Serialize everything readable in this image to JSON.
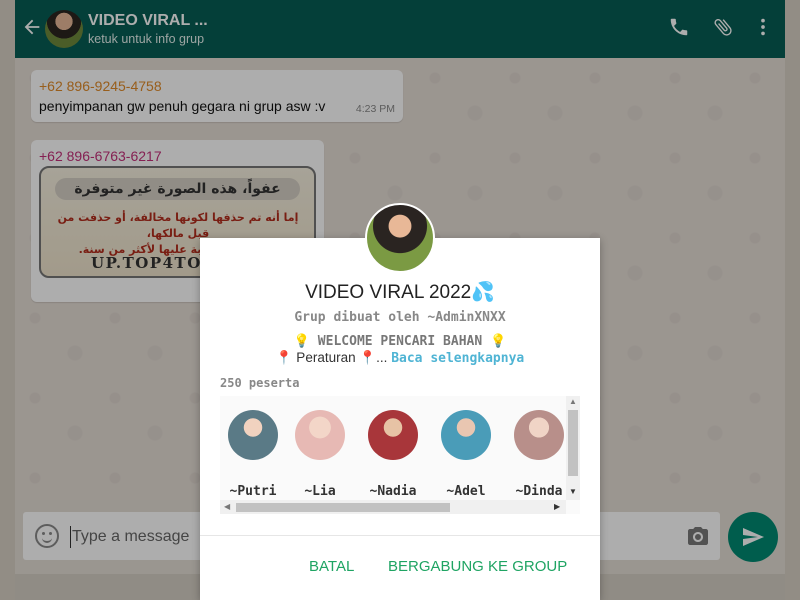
{
  "header": {
    "title": "VIDEO VIRAL ...",
    "subtitle": "ketuk untuk info grup",
    "icons": [
      "back-arrow-icon",
      "phone-icon",
      "paperclip-icon",
      "more-vert-icon"
    ]
  },
  "messages": [
    {
      "sender": "+62 896-9245-4758",
      "text": "penyimpanan gw penuh gegara ni grup asw :v",
      "time": "4:23 PM"
    },
    {
      "sender": "+62 896-6763-6217",
      "image": {
        "line1": "عفواً، هذه الصورة غير متوفرة",
        "line2": "إما أنه تم حذفها لكونها مخالفة، أو حذفت من قبل مالكها،",
        "line3": "أو تمت المطالبة عليها لأكثر من سنة.",
        "watermark": "UP.TOP4TO"
      }
    }
  ],
  "input": {
    "placeholder": "Type a message"
  },
  "dialog": {
    "title": "VIDEO VIRAL 2022💦",
    "creator": "Grup dibuat oleh ~AdminXNXX",
    "desc_line1": "💡 WELCOME PENCARI BAHAN 💡",
    "desc_rules": "📍 Peraturan 📍...",
    "read_more": "Baca selengkapnya",
    "participants": "250 peserta",
    "members": [
      {
        "name": "~Putri",
        "color": "#5a7a86"
      },
      {
        "name": "~Lia",
        "color": "#e7b9b4"
      },
      {
        "name": "~Nadia",
        "color": "#a8363a"
      },
      {
        "name": "~Adel",
        "color": "#4a9cb8"
      },
      {
        "name": "~Dinda",
        "color": "#b88f8a"
      }
    ],
    "cancel_label": "BATAL",
    "join_label": "BERGABUNG KE GROUP"
  },
  "colors": {
    "header": "#075e54",
    "accent": "#1fa463",
    "send": "#008a72"
  }
}
